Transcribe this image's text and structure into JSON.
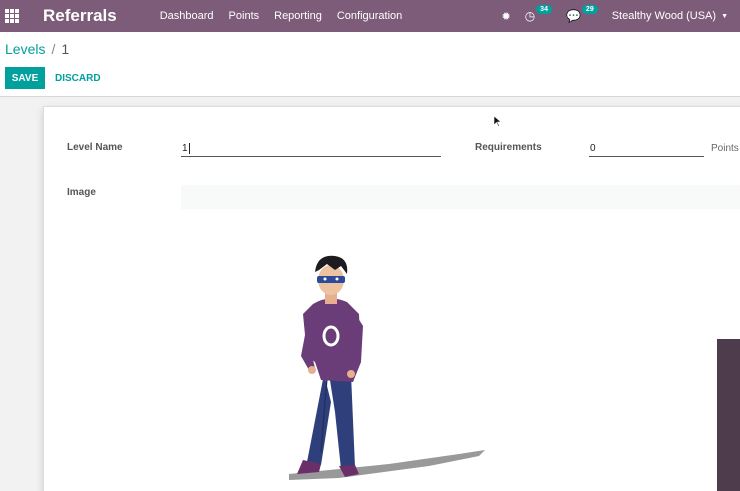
{
  "navbar": {
    "app_title": "Referrals",
    "menu": [
      "Dashboard",
      "Points",
      "Reporting",
      "Configuration"
    ],
    "activity_count": "34",
    "messages_count": "29",
    "company": "Stealthy Wood (USA)",
    "accent_color": "#7c5c78",
    "badge_color": "#00a09d"
  },
  "breadcrumb": {
    "parent": "Levels",
    "separator": "/",
    "current": "1"
  },
  "buttons": {
    "save": "SAVE",
    "discard": "DISCARD"
  },
  "form": {
    "level_name_label": "Level Name",
    "level_name_value": "1",
    "requirements_label": "Requirements",
    "requirements_value": "0",
    "requirements_unit": "Points",
    "image_label": "Image"
  },
  "icons": {
    "apps": "apps-grid-icon",
    "bug": "bug-icon",
    "activity": "clock-icon",
    "messages": "chat-icon",
    "caret": "caret-down-icon"
  }
}
